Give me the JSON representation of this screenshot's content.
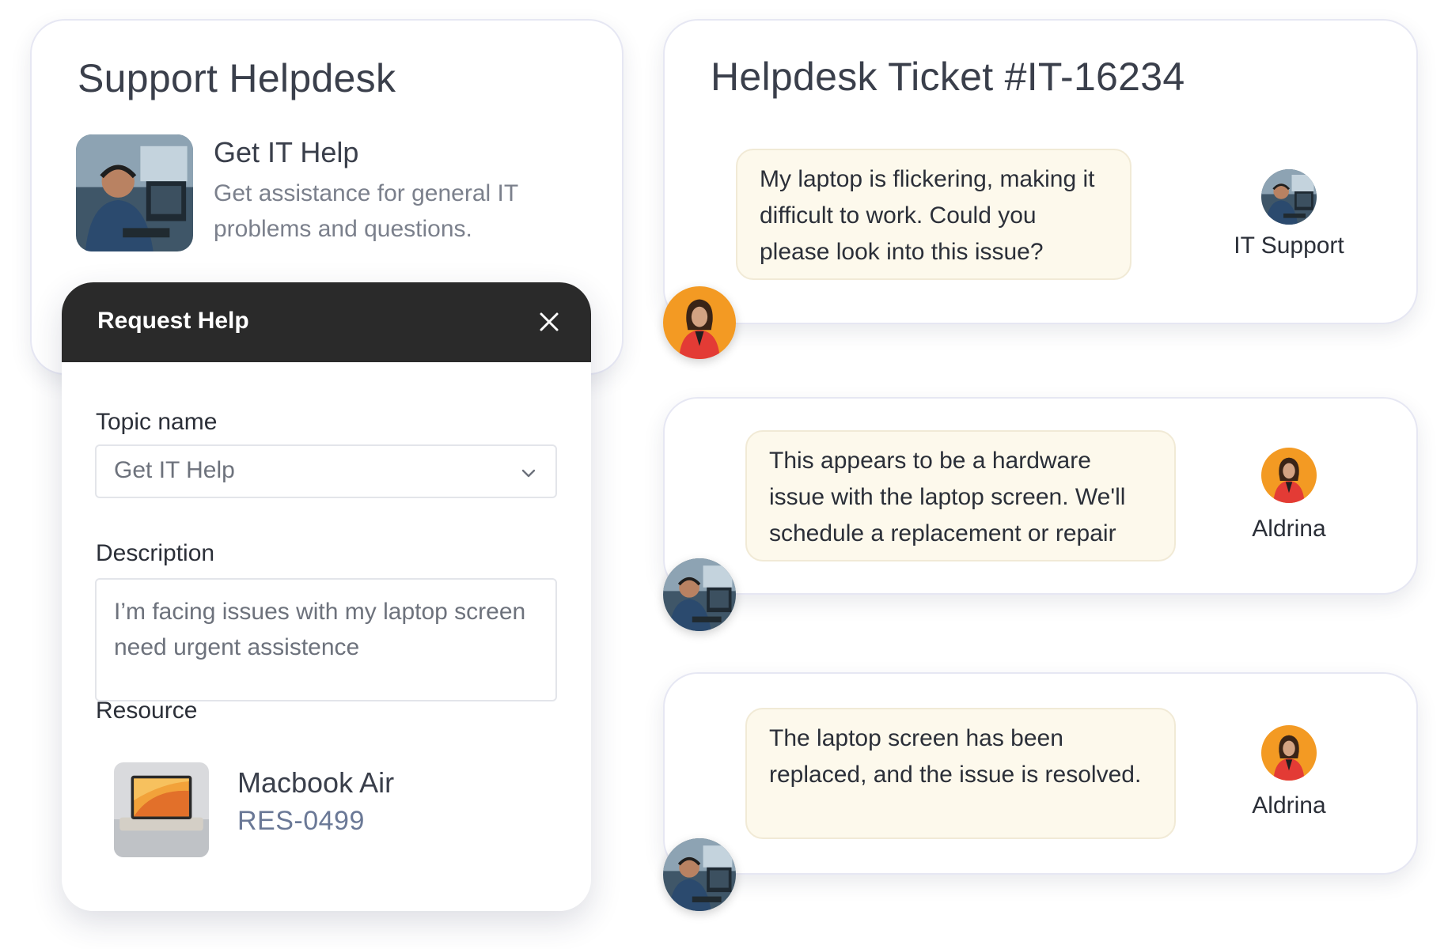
{
  "helpdesk": {
    "title": "Support Helpdesk",
    "service": {
      "name": "Get IT Help",
      "description": "Get assistance for general IT problems and questions."
    }
  },
  "request_panel": {
    "title": "Request Help",
    "topic_label": "Topic name",
    "topic_value": "Get IT Help",
    "description_label": "Description",
    "description_value": "I’m facing issues with my laptop screen need urgent assistence",
    "resource_label": "Resource",
    "resource": {
      "name": "Macbook Air",
      "id": "RES-0499"
    }
  },
  "ticket": {
    "title": "Helpdesk Ticket #IT-16234",
    "messages": [
      {
        "text": "My laptop is flickering, making it difficult to work. Could you please look into this issue?",
        "to_name": "IT Support"
      },
      {
        "text": "This appears to be a hardware issue with the laptop screen. We'll schedule a replacement or repair",
        "to_name": "Aldrina"
      },
      {
        "text": "The laptop screen has been replaced, and the issue is resolved.",
        "to_name": "Aldrina"
      }
    ]
  },
  "colors": {
    "panel_header": "#2a2a2a",
    "bubble_bg": "#fdf9ec",
    "avatar_orange": "#f39a23",
    "resource_id": "#6a7896"
  },
  "icons": [
    "close-icon",
    "chevron-down-icon"
  ]
}
